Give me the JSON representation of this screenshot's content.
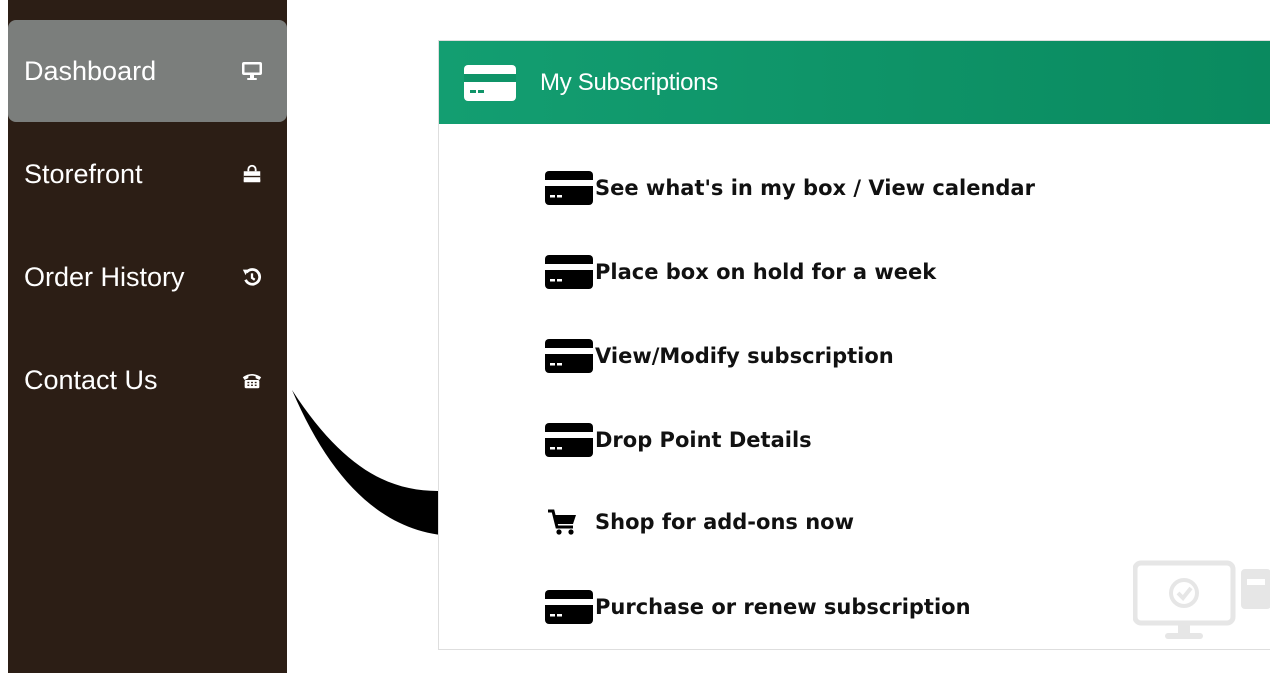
{
  "sidebar": {
    "items": [
      {
        "label": "Dashboard",
        "icon": "monitor-icon",
        "active": true
      },
      {
        "label": "Storefront",
        "icon": "shopping-bag-icon",
        "active": false
      },
      {
        "label": "Order History",
        "icon": "history-icon",
        "active": false
      },
      {
        "label": "Contact Us",
        "icon": "telephone-icon",
        "active": false
      }
    ]
  },
  "panel": {
    "title": "My Subscriptions",
    "header_icon": "credit-card-icon",
    "items": [
      {
        "label": "See what's in my box / View calendar",
        "icon": "credit-card-icon"
      },
      {
        "label": "Place box on hold for a week",
        "icon": "credit-card-icon"
      },
      {
        "label": "View/Modify subscription",
        "icon": "credit-card-icon"
      },
      {
        "label": "Drop Point Details",
        "icon": "credit-card-icon"
      },
      {
        "label": "Shop for add-ons now",
        "icon": "shopping-cart-icon"
      },
      {
        "label": "Purchase or renew subscription",
        "icon": "credit-card-icon"
      }
    ]
  },
  "colors": {
    "sidebar_bg": "#2c1e15",
    "sidebar_active": "#7b7e7c",
    "header_green": "#0a8a5f"
  }
}
